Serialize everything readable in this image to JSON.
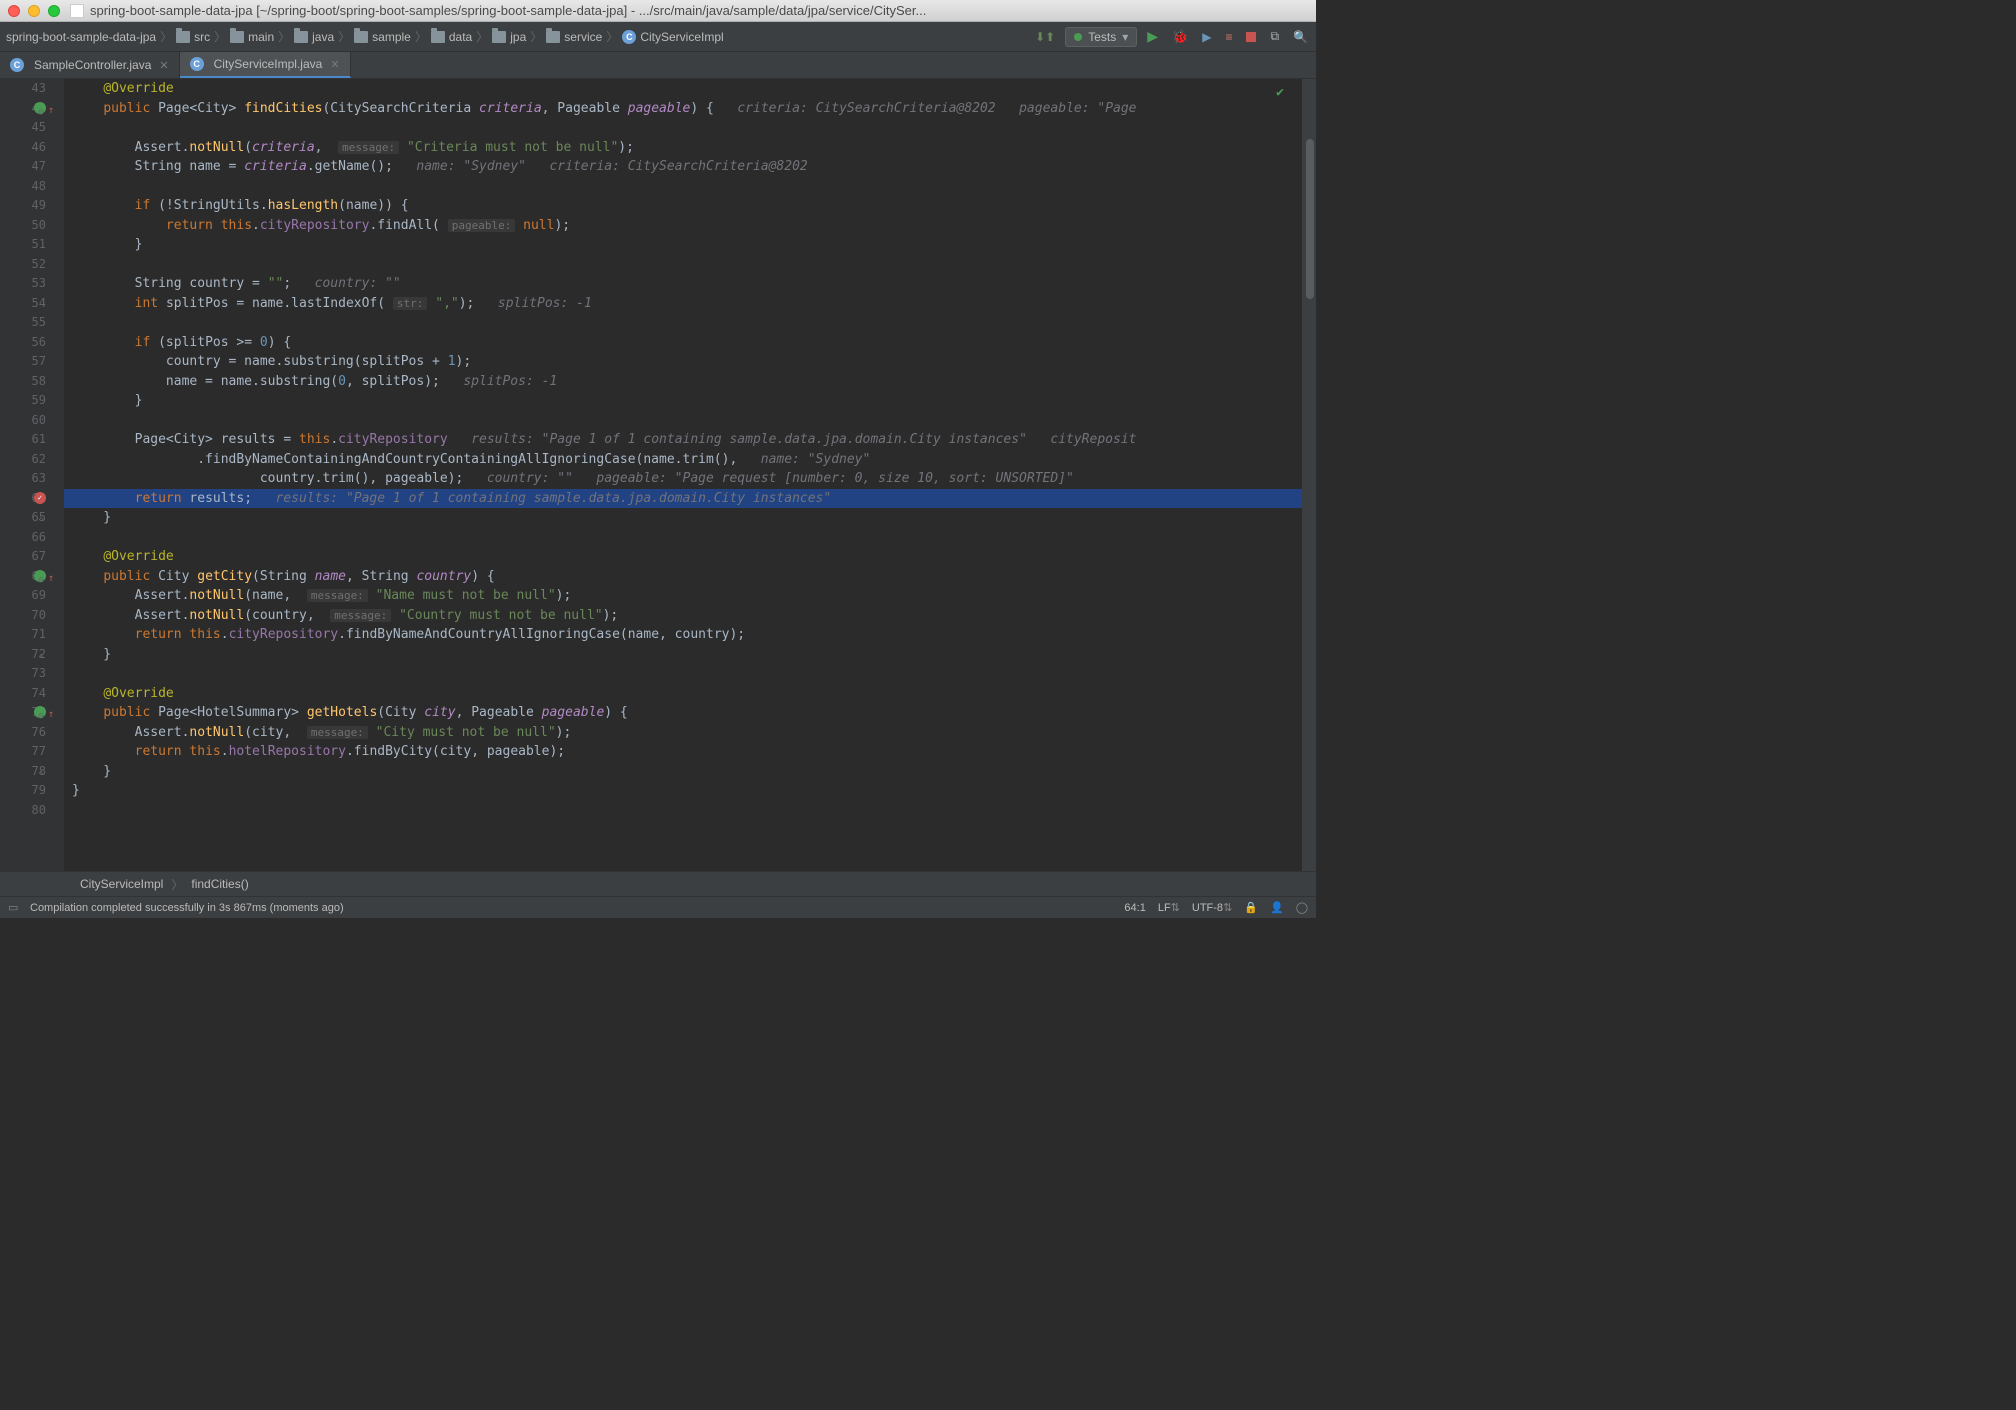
{
  "window": {
    "title": "spring-boot-sample-data-jpa [~/spring-boot/spring-boot-samples/spring-boot-sample-data-jpa] - .../src/main/java/sample/data/jpa/service/CitySer..."
  },
  "breadcrumb": {
    "root": "spring-boot-sample-data-jpa",
    "parts": [
      "src",
      "main",
      "java",
      "sample",
      "data",
      "jpa",
      "service"
    ],
    "file": "CityServiceImpl"
  },
  "runConfig": {
    "label": "Tests"
  },
  "tabs": [
    {
      "label": "SampleController.java",
      "active": false
    },
    {
      "label": "CityServiceImpl.java",
      "active": true
    }
  ],
  "code": {
    "startLine": 43,
    "lines": [
      {
        "n": 43,
        "tokens": [
          [
            "    ",
            ""
          ],
          [
            "@Override",
            "annotation"
          ]
        ]
      },
      {
        "n": 44,
        "tokens": [
          [
            "    ",
            ""
          ],
          [
            "public ",
            "keyword"
          ],
          [
            "Page<City> ",
            "type"
          ],
          [
            "findCities",
            "methoddef"
          ],
          [
            "(CitySearchCriteria ",
            "type"
          ],
          [
            "criteria",
            "italic"
          ],
          [
            ", Pageable ",
            "type"
          ],
          [
            "pageable",
            "italic"
          ],
          [
            ") {   ",
            ""
          ],
          [
            "criteria: CitySearchCriteria@8202   pageable: \"Page",
            "inlay"
          ]
        ],
        "marker": "green-up",
        "fold": "minus"
      },
      {
        "n": 45,
        "tokens": []
      },
      {
        "n": 46,
        "tokens": [
          [
            "        Assert.",
            ""
          ],
          [
            "notNull",
            "method"
          ],
          [
            "(",
            ""
          ],
          [
            "criteria",
            "italic"
          ],
          [
            ",  ",
            ""
          ],
          [
            "message:",
            "hint"
          ],
          [
            " ",
            ""
          ],
          [
            "\"Criteria must not be null\"",
            "string"
          ],
          [
            ");",
            ""
          ]
        ]
      },
      {
        "n": 47,
        "tokens": [
          [
            "        String ",
            "type"
          ],
          [
            "name",
            "ident"
          ],
          [
            " = ",
            ""
          ],
          [
            "criteria",
            "italic"
          ],
          [
            ".getName();   ",
            ""
          ],
          [
            "name: \"Sydney\"   criteria: CitySearchCriteria@8202",
            "inlay"
          ]
        ]
      },
      {
        "n": 48,
        "tokens": []
      },
      {
        "n": 49,
        "tokens": [
          [
            "        ",
            ""
          ],
          [
            "if ",
            "keyword"
          ],
          [
            "(!StringUtils.",
            ""
          ],
          [
            "hasLength",
            "method"
          ],
          [
            "(name)) {",
            ""
          ]
        ]
      },
      {
        "n": 50,
        "tokens": [
          [
            "            ",
            ""
          ],
          [
            "return ",
            "keyword"
          ],
          [
            "this",
            "keyword"
          ],
          [
            ".",
            ""
          ],
          [
            "cityRepository",
            "field"
          ],
          [
            ".findAll( ",
            ""
          ],
          [
            "pageable:",
            "hint"
          ],
          [
            " ",
            ""
          ],
          [
            "null",
            "keyword"
          ],
          [
            ");",
            ""
          ]
        ]
      },
      {
        "n": 51,
        "tokens": [
          [
            "        }",
            ""
          ]
        ]
      },
      {
        "n": 52,
        "tokens": []
      },
      {
        "n": 53,
        "tokens": [
          [
            "        String ",
            "type"
          ],
          [
            "country",
            "ident"
          ],
          [
            " = ",
            ""
          ],
          [
            "\"\"",
            "string"
          ],
          [
            ";   ",
            ""
          ],
          [
            "country: \"\"",
            "inlay"
          ]
        ]
      },
      {
        "n": 54,
        "tokens": [
          [
            "        ",
            ""
          ],
          [
            "int ",
            "keyword"
          ],
          [
            "splitPos = name.lastIndexOf( ",
            ""
          ],
          [
            "str:",
            "hint"
          ],
          [
            " ",
            ""
          ],
          [
            "\",\"",
            "string"
          ],
          [
            ");   ",
            ""
          ],
          [
            "splitPos: -1",
            "inlay"
          ]
        ]
      },
      {
        "n": 55,
        "tokens": []
      },
      {
        "n": 56,
        "tokens": [
          [
            "        ",
            ""
          ],
          [
            "if ",
            "keyword"
          ],
          [
            "(splitPos >= ",
            ""
          ],
          [
            "0",
            "number"
          ],
          [
            ") {",
            ""
          ]
        ]
      },
      {
        "n": 57,
        "tokens": [
          [
            "            country = name.substring(splitPos + ",
            ""
          ],
          [
            "1",
            "number"
          ],
          [
            ");",
            ""
          ]
        ]
      },
      {
        "n": 58,
        "tokens": [
          [
            "            name = name.substring(",
            ""
          ],
          [
            "0",
            "number"
          ],
          [
            ", splitPos);   ",
            ""
          ],
          [
            "splitPos: -1",
            "inlay"
          ]
        ]
      },
      {
        "n": 59,
        "tokens": [
          [
            "        }",
            ""
          ]
        ]
      },
      {
        "n": 60,
        "tokens": []
      },
      {
        "n": 61,
        "tokens": [
          [
            "        Page<City> ",
            "type"
          ],
          [
            "results",
            "ident"
          ],
          [
            " = ",
            ""
          ],
          [
            "this",
            "keyword"
          ],
          [
            ".",
            ""
          ],
          [
            "cityRepository",
            "field"
          ],
          [
            "   ",
            ""
          ],
          [
            "results: \"Page 1 of 1 containing sample.data.jpa.domain.City instances\"   cityReposit",
            "inlay"
          ]
        ]
      },
      {
        "n": 62,
        "tokens": [
          [
            "                .findByNameContainingAndCountryContainingAllIgnoringCase(name.trim(),   ",
            ""
          ],
          [
            "name: \"Sydney\"",
            "inlay"
          ]
        ]
      },
      {
        "n": 63,
        "tokens": [
          [
            "                        country.trim(), pageable);   ",
            ""
          ],
          [
            "country: \"\"   pageable: \"Page request [number: 0, size 10, sort: UNSORTED]\"",
            "inlay"
          ]
        ]
      },
      {
        "n": 64,
        "hl": true,
        "tokens": [
          [
            "        ",
            ""
          ],
          [
            "return ",
            "keyword"
          ],
          [
            "results;   ",
            ""
          ],
          [
            "results: \"Page 1 of 1 containing sample.data.jpa.domain.City instances\"",
            "inlay"
          ]
        ],
        "marker": "red-check"
      },
      {
        "n": 65,
        "tokens": [
          [
            "    }",
            ""
          ]
        ],
        "fold": "up"
      },
      {
        "n": 66,
        "tokens": []
      },
      {
        "n": 67,
        "tokens": [
          [
            "    ",
            ""
          ],
          [
            "@Override",
            "annotation"
          ]
        ]
      },
      {
        "n": 68,
        "tokens": [
          [
            "    ",
            ""
          ],
          [
            "public ",
            "keyword"
          ],
          [
            "City ",
            "type"
          ],
          [
            "getCity",
            "methoddef"
          ],
          [
            "(String ",
            "type"
          ],
          [
            "name",
            "italic"
          ],
          [
            ", String ",
            "type"
          ],
          [
            "country",
            "italic"
          ],
          [
            ") {",
            ""
          ]
        ],
        "marker": "green-up",
        "fold": "minus"
      },
      {
        "n": 69,
        "tokens": [
          [
            "        Assert.",
            ""
          ],
          [
            "notNull",
            "method"
          ],
          [
            "(name,  ",
            ""
          ],
          [
            "message:",
            "hint"
          ],
          [
            " ",
            ""
          ],
          [
            "\"Name must not be null\"",
            "string"
          ],
          [
            ");",
            ""
          ]
        ]
      },
      {
        "n": 70,
        "tokens": [
          [
            "        Assert.",
            ""
          ],
          [
            "notNull",
            "method"
          ],
          [
            "(country,  ",
            ""
          ],
          [
            "message:",
            "hint"
          ],
          [
            " ",
            ""
          ],
          [
            "\"Country must not be null\"",
            "string"
          ],
          [
            ");",
            ""
          ]
        ]
      },
      {
        "n": 71,
        "tokens": [
          [
            "        ",
            ""
          ],
          [
            "return ",
            "keyword"
          ],
          [
            "this",
            "keyword"
          ],
          [
            ".",
            ""
          ],
          [
            "cityRepository",
            "field"
          ],
          [
            ".findByNameAndCountryAllIgnoringCase(name, country);",
            ""
          ]
        ]
      },
      {
        "n": 72,
        "tokens": [
          [
            "    }",
            ""
          ]
        ],
        "fold": "up"
      },
      {
        "n": 73,
        "tokens": []
      },
      {
        "n": 74,
        "tokens": [
          [
            "    ",
            ""
          ],
          [
            "@Override",
            "annotation"
          ]
        ]
      },
      {
        "n": 75,
        "tokens": [
          [
            "    ",
            ""
          ],
          [
            "public ",
            "keyword"
          ],
          [
            "Page<HotelSummary> ",
            "type"
          ],
          [
            "getHotels",
            "methoddef"
          ],
          [
            "(City ",
            "type"
          ],
          [
            "city",
            "italic"
          ],
          [
            ", Pageable ",
            "type"
          ],
          [
            "pageable",
            "italic"
          ],
          [
            ") {",
            ""
          ]
        ],
        "marker": "green-up",
        "fold": "minus"
      },
      {
        "n": 76,
        "tokens": [
          [
            "        Assert.",
            ""
          ],
          [
            "notNull",
            "method"
          ],
          [
            "(city,  ",
            ""
          ],
          [
            "message:",
            "hint"
          ],
          [
            " ",
            ""
          ],
          [
            "\"City must not be null\"",
            "string"
          ],
          [
            ");",
            ""
          ]
        ]
      },
      {
        "n": 77,
        "tokens": [
          [
            "        ",
            ""
          ],
          [
            "return ",
            "keyword"
          ],
          [
            "this",
            "keyword"
          ],
          [
            ".",
            ""
          ],
          [
            "hotelRepository",
            "field"
          ],
          [
            ".findByCity(city, pageable);",
            ""
          ]
        ]
      },
      {
        "n": 78,
        "tokens": [
          [
            "    }",
            ""
          ]
        ],
        "fold": "up"
      },
      {
        "n": 79,
        "tokens": [
          [
            "}",
            ""
          ]
        ]
      },
      {
        "n": 80,
        "tokens": []
      }
    ]
  },
  "bottomCrumb": {
    "class": "CityServiceImpl",
    "method": "findCities()"
  },
  "status": {
    "message": "Compilation completed successfully in 3s 867ms (moments ago)",
    "position": "64:1",
    "lineSep": "LF",
    "encoding": "UTF-8"
  }
}
